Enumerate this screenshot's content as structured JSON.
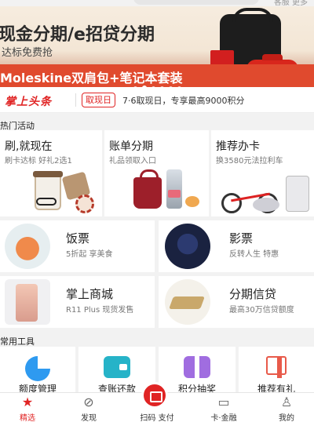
{
  "header": {
    "links": "客服  更多"
  },
  "banner": {
    "line1": "现金分期/e招贷分期",
    "line2": "达标免费抢",
    "line3": "Moleskine双肩包+笔记本套装",
    "page_count": 6,
    "active_page": 2
  },
  "headline": {
    "logo": "掌上头条",
    "tag": "取现日",
    "text": "7·6取现日，专享最高9000积分"
  },
  "hot_section": {
    "title": "热门活动",
    "cards": [
      {
        "title": "刷,就现在",
        "subtitle": "刷卡达标 好礼2选1"
      },
      {
        "title": "账单分期",
        "subtitle": "礼品领取入口"
      },
      {
        "title": "推荐办卡",
        "subtitle": "换3580元法拉利车"
      }
    ]
  },
  "grid": [
    {
      "title": "饭票",
      "subtitle": "5折起 享美食",
      "icon": "food-icon"
    },
    {
      "title": "影票",
      "subtitle": "反转人生 特惠",
      "icon": "movie-icon"
    },
    {
      "title": "掌上商城",
      "subtitle": "R11 Plus 现货发售",
      "icon": "phone-icon"
    },
    {
      "title": "分期信贷",
      "subtitle": "最高30万信贷额度",
      "icon": "gold-icon"
    }
  ],
  "tools_section": {
    "title": "常用工具",
    "items": [
      {
        "label": "额度管理",
        "icon": "pie-chart-icon"
      },
      {
        "label": "查账还款",
        "icon": "wallet-icon"
      },
      {
        "label": "积分抽奖",
        "icon": "gift-box-icon"
      },
      {
        "label": "推荐有礼",
        "icon": "present-icon"
      }
    ]
  },
  "nav": {
    "items": [
      {
        "label": "精选",
        "icon": "star-icon",
        "active": true
      },
      {
        "label": "发现",
        "icon": "compass-icon",
        "active": false
      },
      {
        "label": "扫码 支付",
        "icon": "scan-icon",
        "active": false
      },
      {
        "label": "卡·金融",
        "icon": "card-icon",
        "active": false
      },
      {
        "label": "我的",
        "icon": "user-icon",
        "active": false
      }
    ]
  },
  "colors": {
    "accent": "#e02424",
    "banner_strip": "#e04a2e"
  }
}
